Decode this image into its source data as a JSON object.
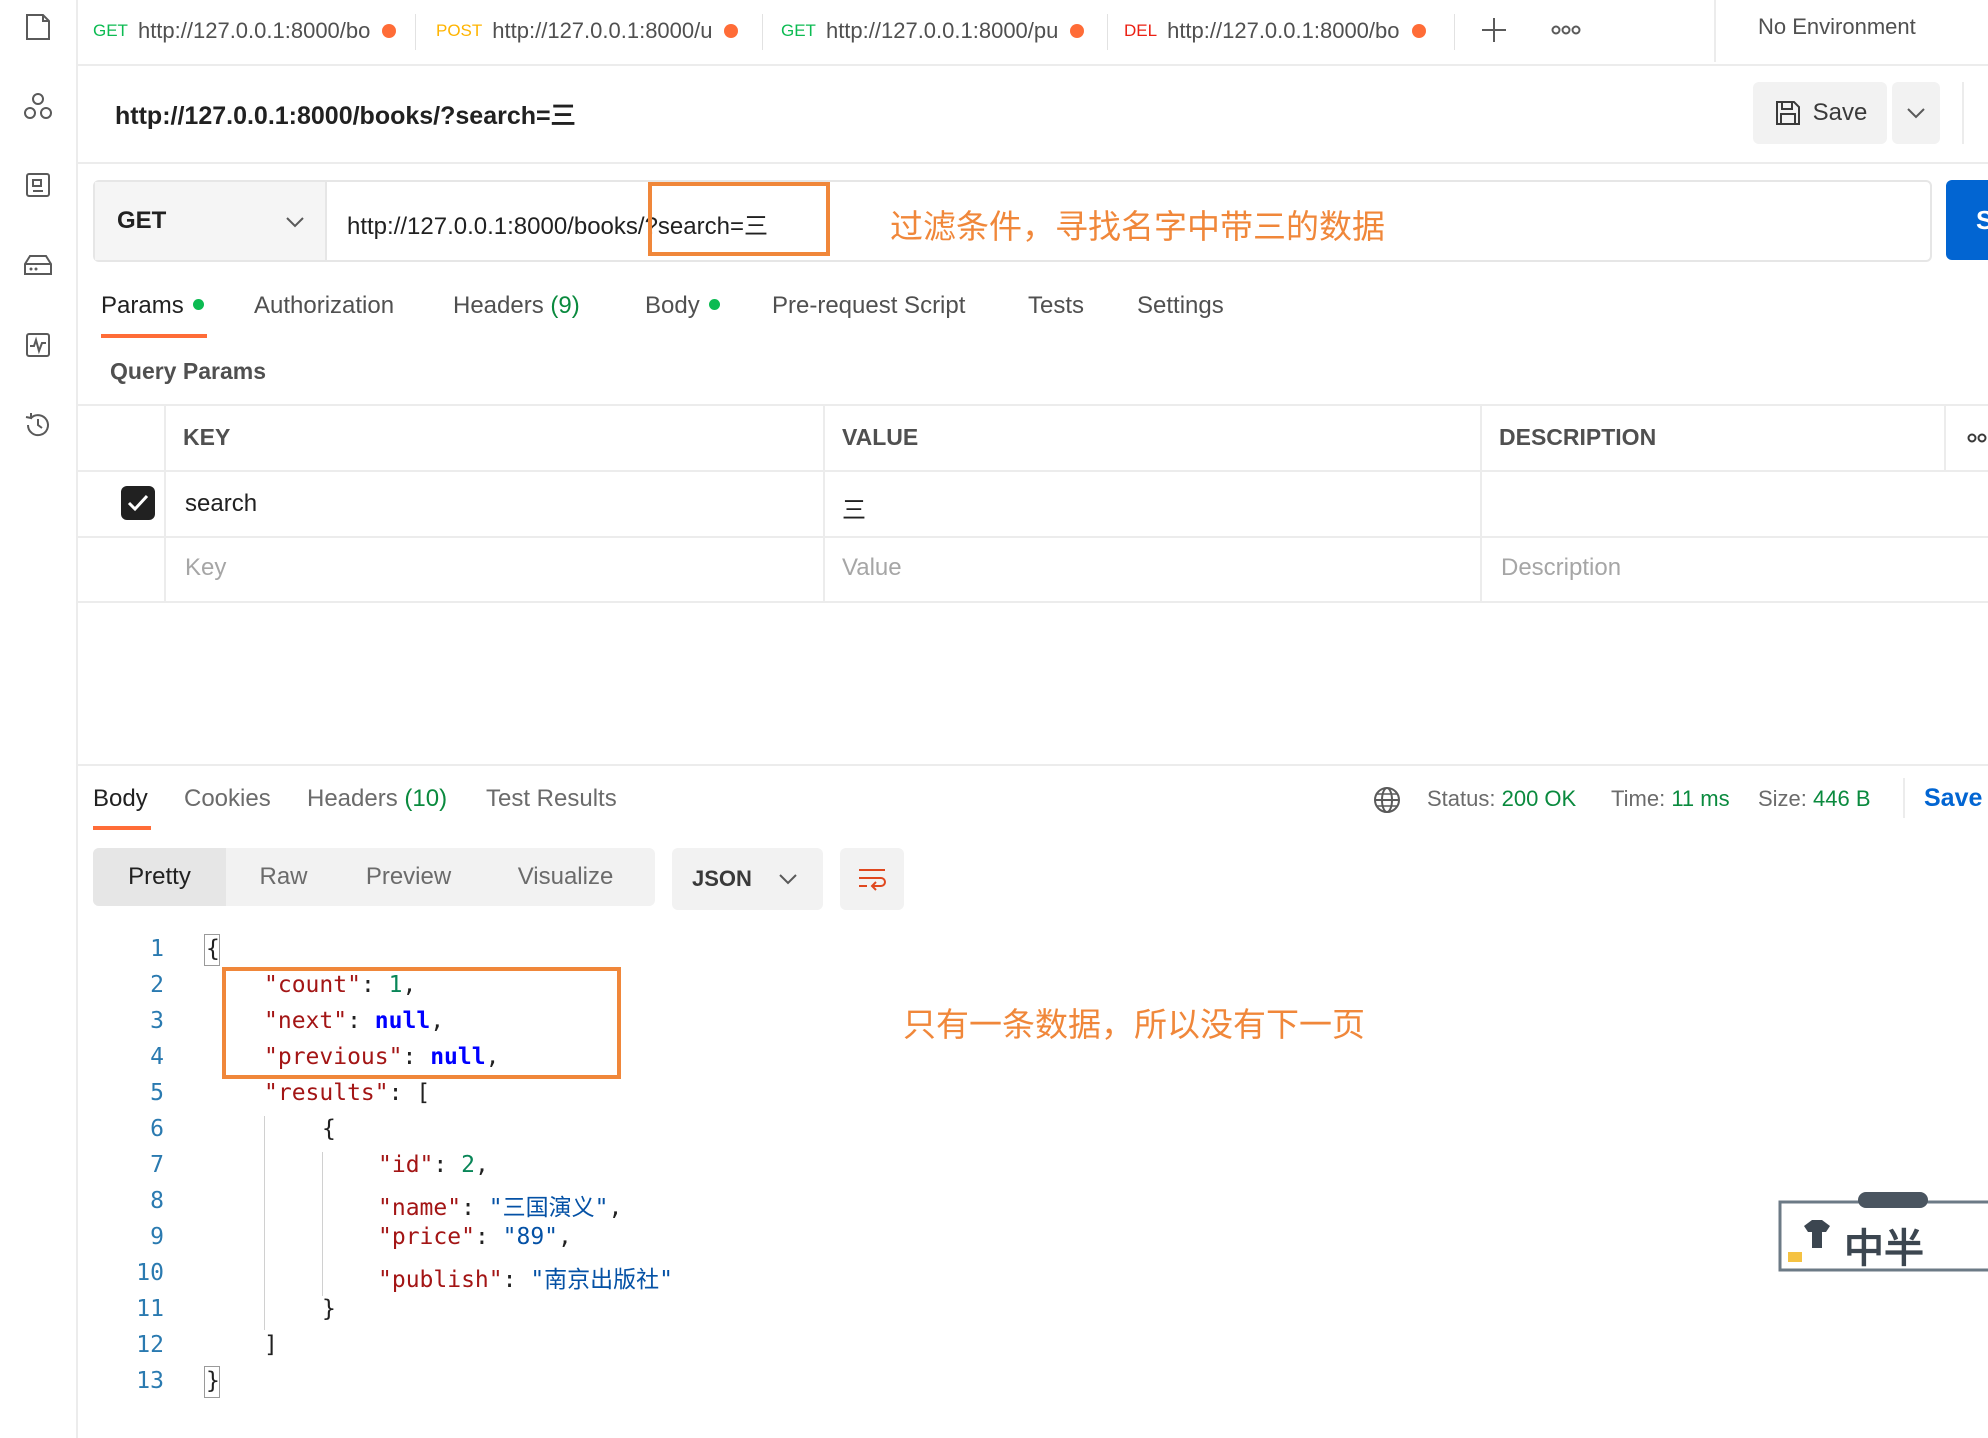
{
  "tabs": [
    {
      "method": "GET",
      "method_color": "#0cbb52",
      "url": "http://127.0.0.1:8000/bo"
    },
    {
      "method": "POST",
      "method_color": "#ffb400",
      "url": "http://127.0.0.1:8000/u"
    },
    {
      "method": "GET",
      "method_color": "#0cbb52",
      "url": "http://127.0.0.1:8000/pu"
    },
    {
      "method": "DEL",
      "method_color": "#eb2013",
      "url": "http://127.0.0.1:8000/bo"
    }
  ],
  "environment": "No Environment",
  "request": {
    "title": "http://127.0.0.1:8000/books/?search=三",
    "save_label": "Save",
    "method": "GET",
    "url": "http://127.0.0.1:8000/books/?search=三",
    "send_label": "S"
  },
  "annotations": {
    "filter_note": "过滤条件，寻找名字中带三的数据",
    "page_note": "只有一条数据，所以没有下一页"
  },
  "request_tabs": {
    "params": "Params",
    "authorization": "Authorization",
    "headers": "Headers",
    "headers_count": "(9)",
    "body": "Body",
    "pre_request": "Pre-request Script",
    "tests": "Tests",
    "settings": "Settings"
  },
  "query_params": {
    "title": "Query Params",
    "headers": {
      "key": "KEY",
      "value": "VALUE",
      "description": "DESCRIPTION"
    },
    "rows": [
      {
        "key": "search",
        "value": "三",
        "description": "",
        "checked": true
      }
    ],
    "placeholders": {
      "key": "Key",
      "value": "Value",
      "description": "Description"
    }
  },
  "response_tabs": {
    "body": "Body",
    "cookies": "Cookies",
    "headers": "Headers",
    "headers_count": "(10)",
    "test_results": "Test Results"
  },
  "status": {
    "status_label": "Status:",
    "status_value": "200 OK",
    "time_label": "Time:",
    "time_value": "11 ms",
    "size_label": "Size:",
    "size_value": "446 B",
    "save_label": "Save"
  },
  "view_modes": [
    "Pretty",
    "Raw",
    "Preview",
    "Visualize"
  ],
  "format": "JSON",
  "code": {
    "line_numbers": [
      "1",
      "2",
      "3",
      "4",
      "5",
      "6",
      "7",
      "8",
      "9",
      "10",
      "11",
      "12",
      "13"
    ],
    "lines": {
      "l1": "{",
      "count_key": "\"count\"",
      "count_val": "1",
      "next_key": "\"next\"",
      "next_val": "null",
      "prev_key": "\"previous\"",
      "prev_val": "null",
      "results_key": "\"results\"",
      "results_open": "[",
      "obj_open": "{",
      "id_key": "\"id\"",
      "id_val": "2",
      "name_key": "\"name\"",
      "name_val": "\"三国演义\"",
      "price_key": "\"price\"",
      "price_val": "\"89\"",
      "publish_key": "\"publish\"",
      "publish_val": "\"南京出版社\"",
      "obj_close": "}",
      "results_close": "]",
      "l13": "}"
    }
  },
  "sticker_text": "中半",
  "colors": {
    "accent": "#ff6c37",
    "annotation": "#f0873a",
    "send": "#0265d2",
    "success": "#0a8a3e"
  }
}
